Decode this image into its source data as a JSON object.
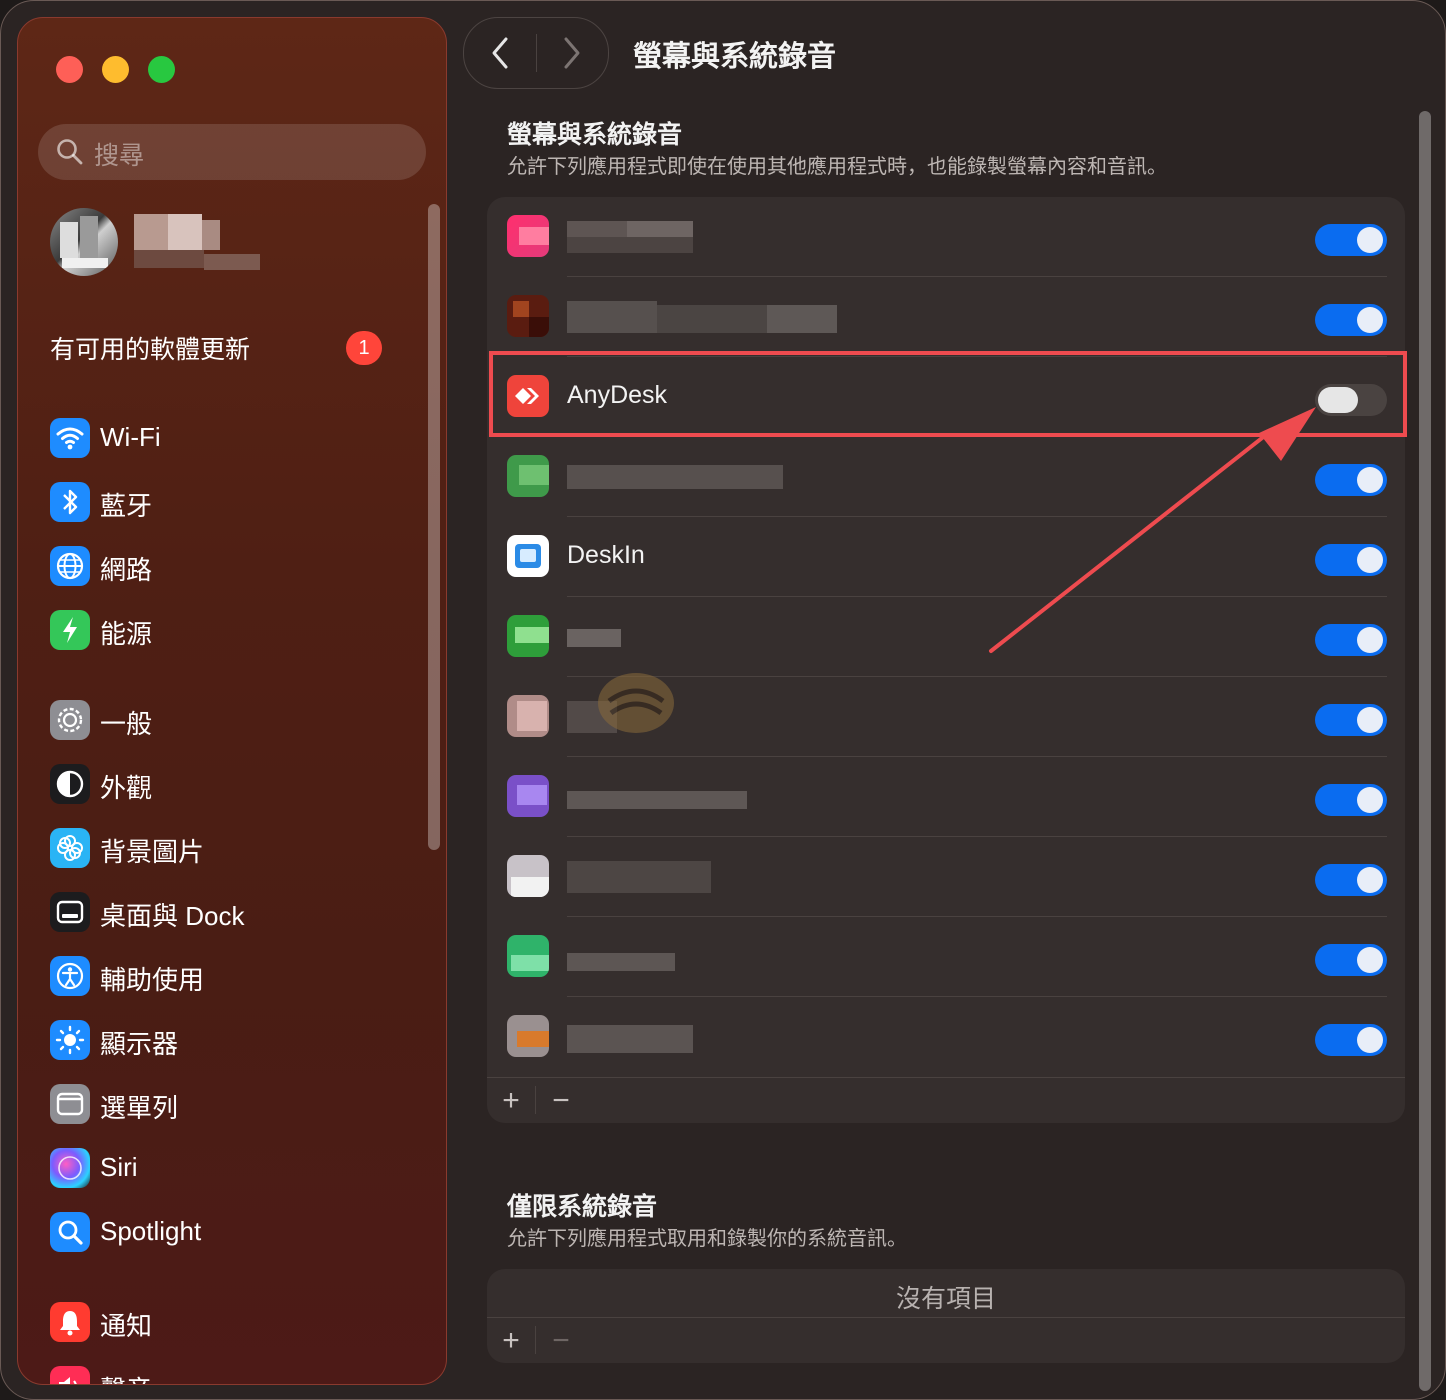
{
  "window": {
    "title": "螢幕與系統錄音"
  },
  "sidebar": {
    "search_placeholder": "搜尋",
    "update_label": "有可用的軟體更新",
    "update_badge": "1",
    "items": [
      {
        "label": "Wi-Fi",
        "icon": "wifi-icon",
        "color": "#1e8cff"
      },
      {
        "label": "藍牙",
        "icon": "bluetooth-icon",
        "color": "#1e8cff"
      },
      {
        "label": "網路",
        "icon": "globe-icon",
        "color": "#1e8cff"
      },
      {
        "label": "能源",
        "icon": "battery-icon",
        "color": "#34c759"
      },
      {
        "label": "一般",
        "icon": "gear-icon",
        "color": "#8e8e93"
      },
      {
        "label": "外觀",
        "icon": "appearance-icon",
        "color": "#1c1c1e"
      },
      {
        "label": "背景圖片",
        "icon": "flower-icon",
        "color": "#2ab4f5"
      },
      {
        "label": "桌面與 Dock",
        "icon": "dock-icon",
        "color": "#1c1c1e"
      },
      {
        "label": "輔助使用",
        "icon": "accessibility-icon",
        "color": "#1e8cff"
      },
      {
        "label": "顯示器",
        "icon": "sun-icon",
        "color": "#1e8cff"
      },
      {
        "label": "選單列",
        "icon": "menubar-icon",
        "color": "#8e8e93"
      },
      {
        "label": "Siri",
        "icon": "siri-icon",
        "color": "#1c1c1e"
      },
      {
        "label": "Spotlight",
        "icon": "spotlight-icon",
        "color": "#1e8cff"
      },
      {
        "label": "通知",
        "icon": "bell-icon",
        "color": "#ff3b30"
      },
      {
        "label": "聲音",
        "icon": "speaker-icon",
        "color": "#ff2d55"
      }
    ]
  },
  "main": {
    "section1_title": "螢幕與系統錄音",
    "section1_desc": "允許下列應用程式即使在使用其他應用程式時，也能錄製螢幕內容和音訊。",
    "apps": [
      {
        "name": "",
        "enabled": true
      },
      {
        "name": "",
        "enabled": true
      },
      {
        "name": "AnyDesk",
        "enabled": false
      },
      {
        "name": "",
        "enabled": true
      },
      {
        "name": "DeskIn",
        "enabled": true
      },
      {
        "name": "",
        "enabled": true
      },
      {
        "name": "",
        "enabled": true
      },
      {
        "name": "",
        "enabled": true
      },
      {
        "name": "",
        "enabled": true
      },
      {
        "name": "",
        "enabled": true
      },
      {
        "name": "",
        "enabled": true
      }
    ],
    "add_label": "+",
    "remove_label": "−",
    "section2_title": "僅限系統錄音",
    "section2_desc": "允許下列應用程式取用和錄製你的系統音訊。",
    "section2_empty": "沒有項目",
    "accent_color": "#0a6cf0",
    "highlight_color": "#ee4b4f"
  }
}
